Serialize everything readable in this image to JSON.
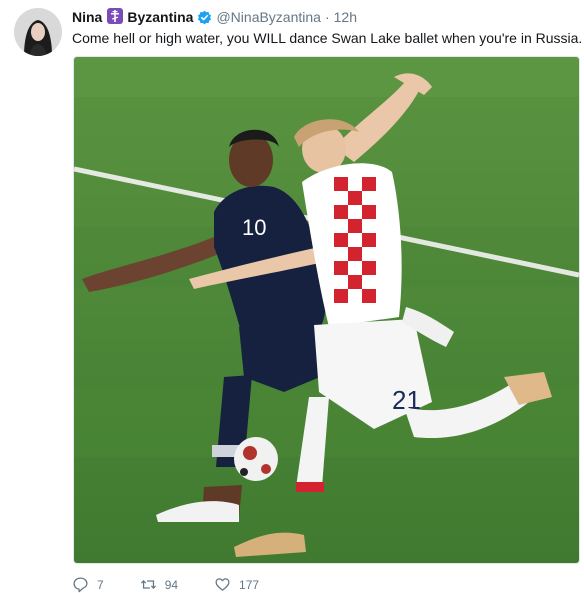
{
  "tweet": {
    "author": {
      "display_name": "Nina",
      "display_name_suffix": "Byzantina",
      "handle": "@NinaByzantina",
      "verified": true
    },
    "separator": "·",
    "timestamp": "12h",
    "text": "Come hell or high water, you WILL dance Swan Lake ballet when you're in Russia.",
    "image": {
      "jersey_numbers": [
        "10",
        "21"
      ]
    },
    "actions": {
      "reply_count": "7",
      "retweet_count": "94",
      "like_count": "177"
    }
  },
  "colors": {
    "verified_blue": "#1da1f2",
    "meta_gray": "#657786",
    "pitch_green": "#4f8a3a",
    "emoji_purple": "#7b4bb7"
  },
  "icons": [
    "reply-icon",
    "retweet-icon",
    "like-icon",
    "verified-badge-icon",
    "orthodox-cross-emoji-icon"
  ]
}
